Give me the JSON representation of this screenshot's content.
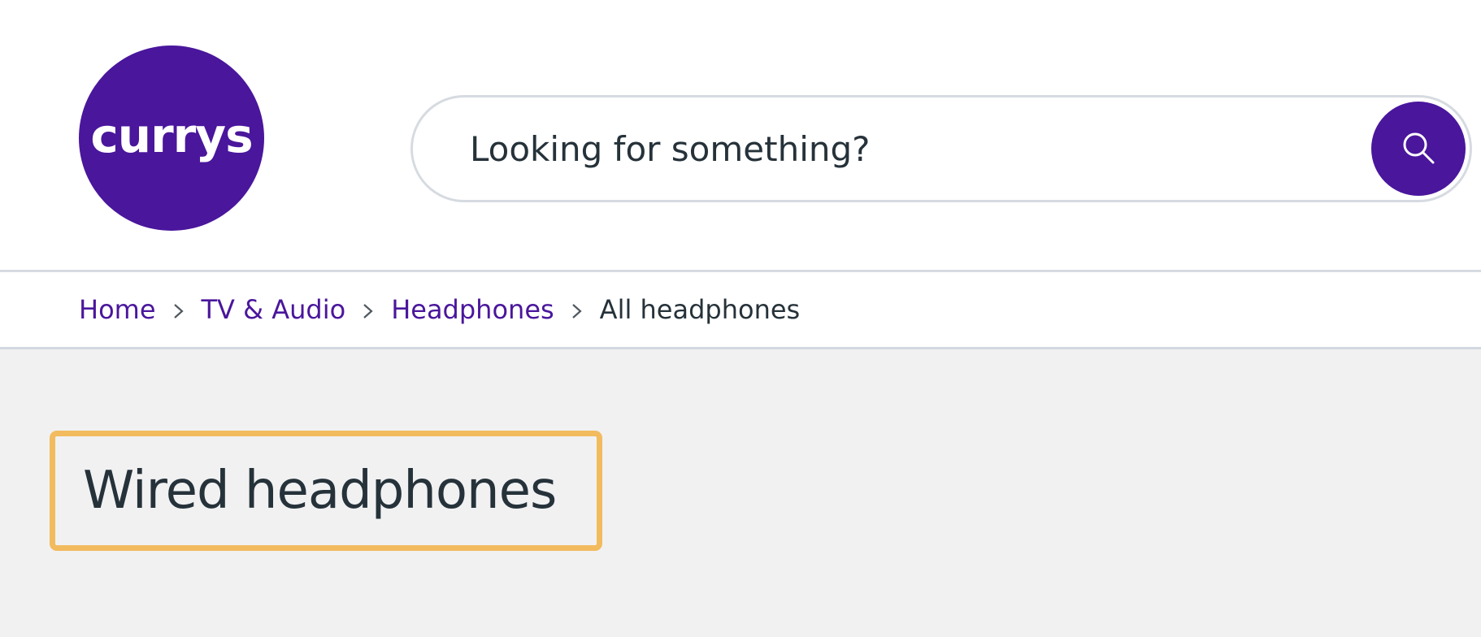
{
  "header": {
    "logo_text": "currys",
    "search": {
      "placeholder": "Looking for something?",
      "value": "",
      "button_icon": "search-icon"
    }
  },
  "breadcrumb": {
    "items": [
      {
        "label": "Home",
        "link": true
      },
      {
        "label": "TV & Audio",
        "link": true
      },
      {
        "label": "Headphones",
        "link": true
      },
      {
        "label": "All headphones",
        "link": false
      }
    ],
    "separator_icon": "chevron-right-icon"
  },
  "main": {
    "title": "Wired headphones"
  },
  "colors": {
    "brand": "#4a169c",
    "text": "#26323a",
    "highlight_border": "#f2bb5e",
    "content_bg": "#f1f1f2",
    "border": "#d6dbe1"
  }
}
